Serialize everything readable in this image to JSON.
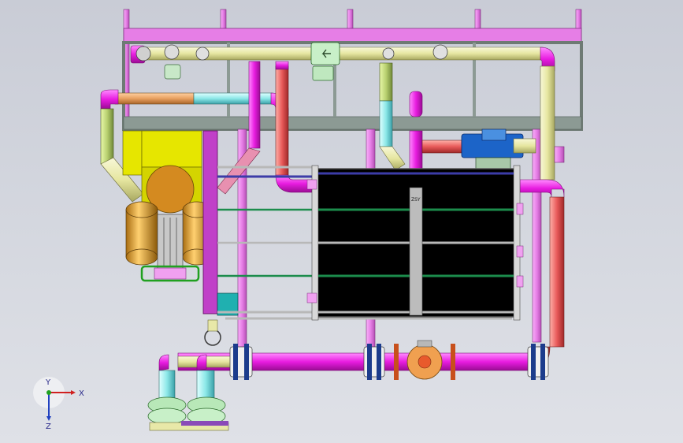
{
  "viewport": {
    "background_top": "#c9ccd6",
    "background_bottom": "#dfe1e7"
  },
  "colors": {
    "frame": "#e67ee6",
    "frame_grey": "#8c9a94",
    "pipe_cream": "#e8e8a8",
    "pipe_magenta": "#e81ce0",
    "pipe_red": "#e85a5a",
    "pipe_cyan": "#8ce8e8",
    "pipe_orange": "#e8a060",
    "heat_exchanger": "#000000",
    "tank": "#d4a040",
    "pump_yellow": "#e6e600",
    "valve_blue": "#1c64c8",
    "flange_orange": "#f0a050"
  },
  "model": {
    "plate_label": "ZSY"
  },
  "triad": {
    "x_label": "X",
    "y_label": "Y",
    "z_label": "Z"
  },
  "icons": {
    "flow_arrow": "left-arrow-icon",
    "coordinate_triad": "xyz-triad-icon"
  }
}
